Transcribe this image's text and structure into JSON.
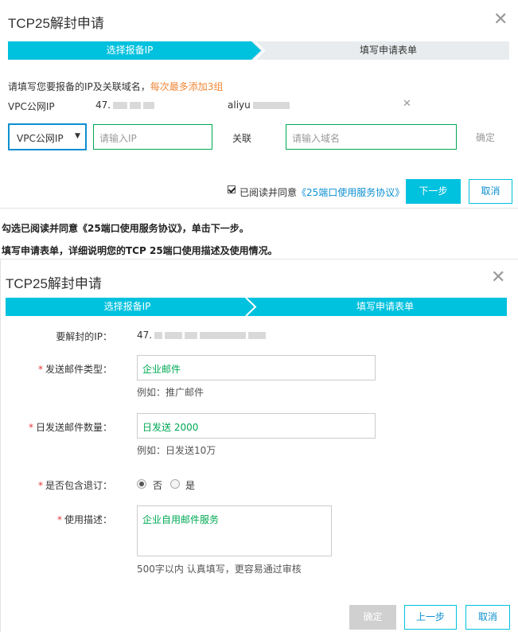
{
  "dialog1": {
    "title": "TCP25解封申请",
    "steps": [
      "选择报备IP",
      "填写申请表单"
    ],
    "instruction": "请填写您要报备的IP及关联域名，",
    "instruction_highlight": "每次最多添加3组",
    "entry": {
      "type": "VPC公网IP",
      "ip": "47.",
      "domain": "aliyu"
    },
    "select_value": "VPC公网IP",
    "ip_placeholder": "请输入IP",
    "link_label": "关联",
    "domain_placeholder": "请输入域名",
    "confirm_label": "确定",
    "agree_text": "已阅读并同意",
    "agree_link": "《25端口使用服务协议》",
    "next_label": "下一步",
    "cancel_label": "取消"
  },
  "instructions": {
    "line1": "勾选已阅读并同意《25端口使用服务协议》，单击下一步。",
    "line2": "填写申请表单，详细说明您的TCP 25端口使用描述及使用情况。"
  },
  "dialog2": {
    "title": "TCP25解封申请",
    "steps": [
      "选择报备IP",
      "填写申请表单"
    ],
    "ip_label": "要解封的IP：",
    "ip_value": "47.",
    "mail_type_label": "发送邮件类型：",
    "mail_type_value": "企业邮件",
    "mail_type_hint": "例如：推广邮件",
    "daily_label": "日发送邮件数量：",
    "daily_value": "日发送 2000",
    "daily_hint": "例如：日发送10万",
    "unsub_label": "是否包含退订：",
    "unsub_options": [
      "否",
      "是"
    ],
    "desc_label": "使用描述：",
    "desc_value": "企业自用邮件服务",
    "desc_hint": "500字以内 认真填写，更容易通过审核",
    "confirm_label": "确定",
    "prev_label": "上一步",
    "cancel_label": "取消"
  },
  "colors": {
    "accent": "#00c1de",
    "field_border": "#00a854",
    "link": "#0c8fd0",
    "highlight": "#f08737"
  }
}
